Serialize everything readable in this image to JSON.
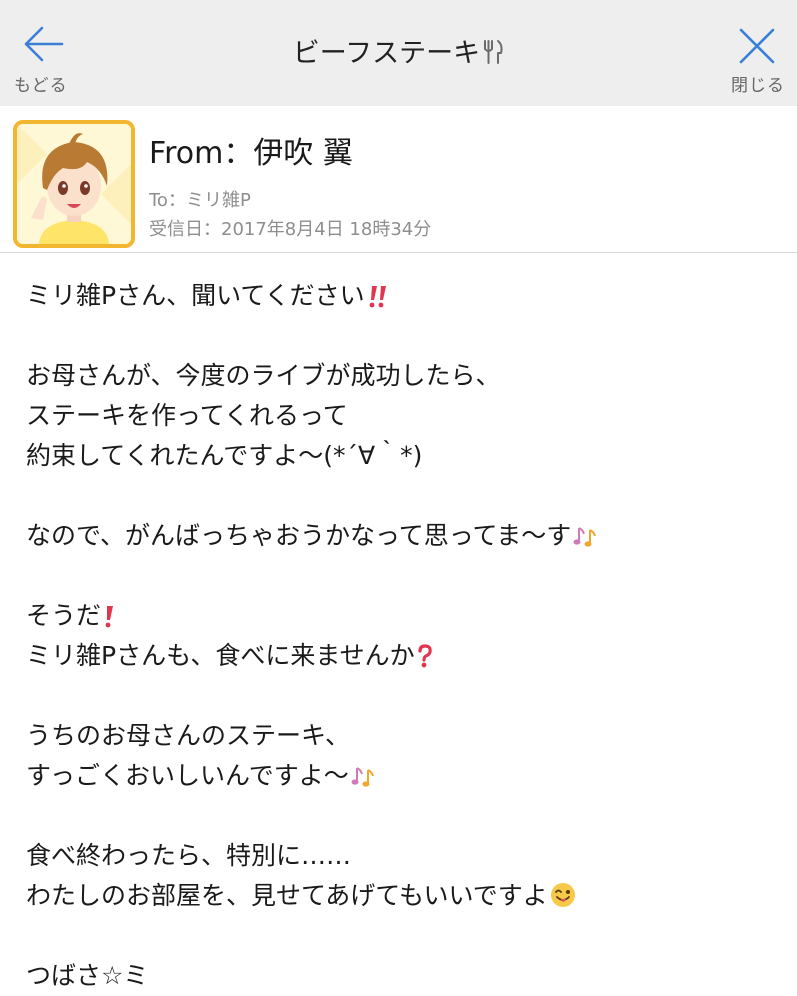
{
  "nav": {
    "back_label": "もどる",
    "close_label": "閉じる",
    "title": "ビーフステーキ"
  },
  "message": {
    "from": "From：伊吹 翼",
    "to": "To：ミリ雑P",
    "date": "受信日：2017年8月4日 18時34分"
  },
  "body": {
    "l1": "ミリ雑Pさん、聞いてください",
    "l2": "お母さんが、今度のライブが成功したら、",
    "l3": "ステーキを作ってくれるって",
    "l4": "約束してくれたんですよ〜(*´∀｀*)",
    "l5": "なので、がんばっちゃおうかなって思ってま〜す",
    "l6": "そうだ",
    "l7": "ミリ雑Pさんも、食べに来ませんか",
    "l8": "うちのお母さんのステーキ、",
    "l9": "すっごくおいしいんですよ〜",
    "l10": "食べ終わったら、特別に……",
    "l11": "わたしのお部屋を、見せてあげてもいいですよ",
    "l12": "つばさ☆ミ"
  },
  "icons": {
    "back": "arrow-left-icon",
    "close": "close-icon",
    "fork_knife": "fork-knife-icon",
    "double_exclamation": "double-exclamation-icon",
    "exclamation": "exclamation-icon",
    "question": "question-icon",
    "music_notes": "music-notes-icon",
    "winking_tongue_face": "winking-tongue-face-icon"
  },
  "colors": {
    "accent_blue": "#3a7fd5",
    "avatar_border": "#f2b630",
    "emoji_red": "#e0364f"
  }
}
